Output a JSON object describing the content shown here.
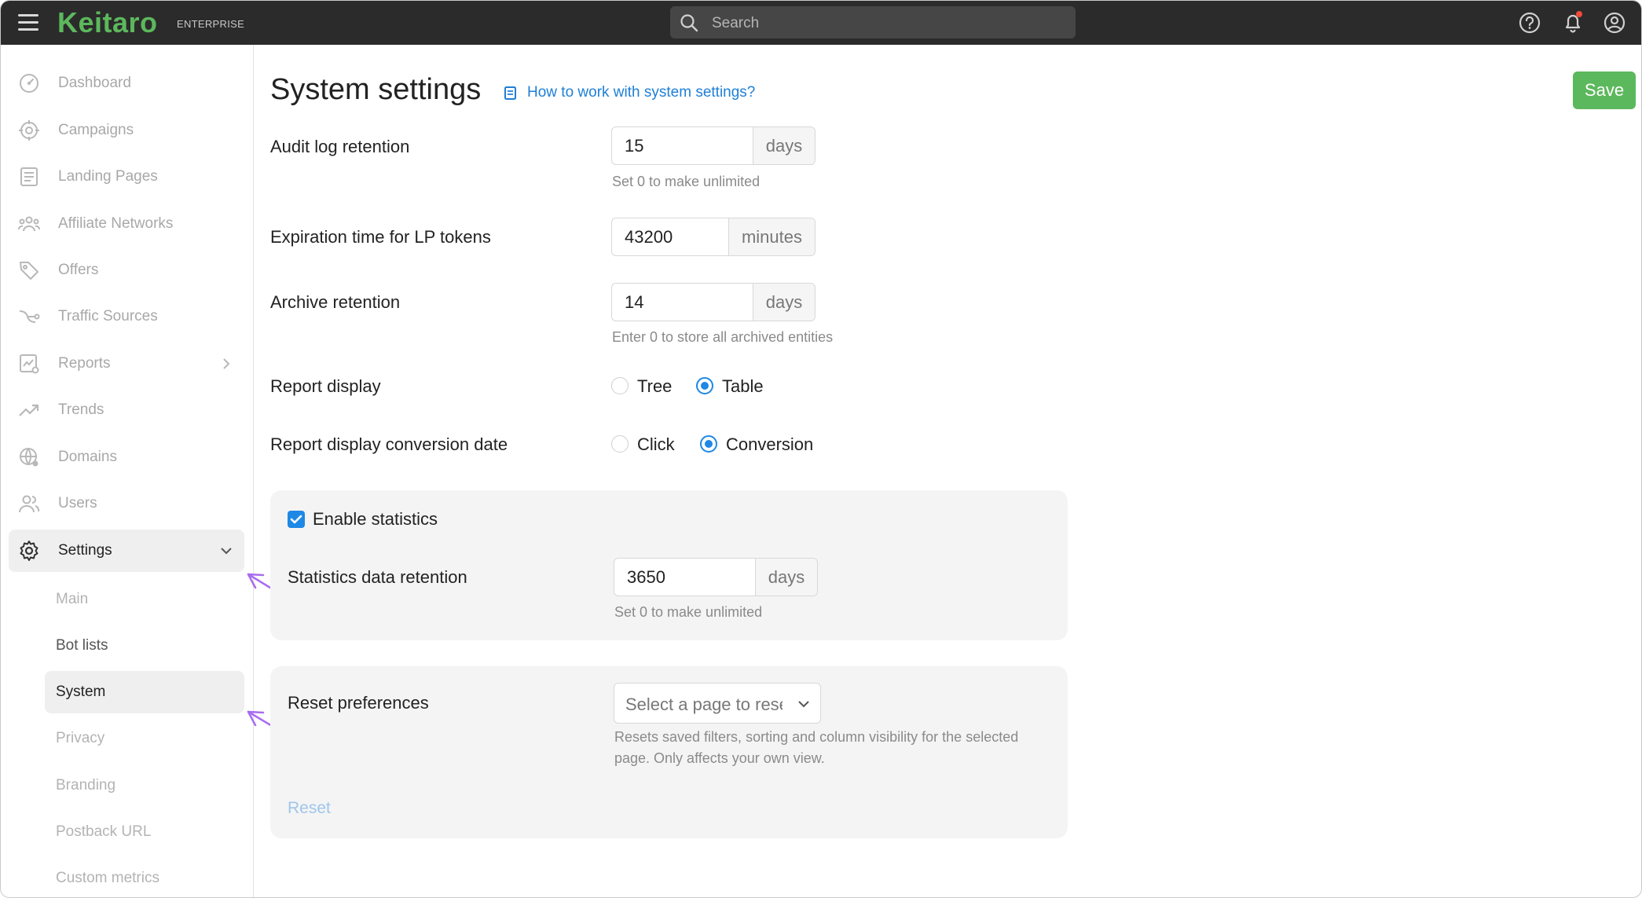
{
  "topbar": {
    "logo": "Keitaro",
    "logo_sub": "ENTERPRISE",
    "search_placeholder": "Search"
  },
  "sidebar": {
    "items": [
      {
        "label": "Dashboard",
        "icon": "dashboard-icon"
      },
      {
        "label": "Campaigns",
        "icon": "target-icon"
      },
      {
        "label": "Landing Pages",
        "icon": "page-icon"
      },
      {
        "label": "Affiliate Networks",
        "icon": "people-network-icon"
      },
      {
        "label": "Offers",
        "icon": "tag-icon"
      },
      {
        "label": "Traffic Sources",
        "icon": "traffic-icon"
      },
      {
        "label": "Reports",
        "icon": "report-chart-icon"
      },
      {
        "label": "Trends",
        "icon": "trend-icon"
      },
      {
        "label": "Domains",
        "icon": "globe-icon"
      },
      {
        "label": "Users",
        "icon": "users-icon"
      },
      {
        "label": "Settings",
        "icon": "gear-icon"
      }
    ],
    "settings_sub": [
      {
        "label": "Main"
      },
      {
        "label": "Bot lists"
      },
      {
        "label": "System"
      },
      {
        "label": "Privacy"
      },
      {
        "label": "Branding"
      },
      {
        "label": "Postback URL"
      },
      {
        "label": "Custom metrics"
      }
    ]
  },
  "main": {
    "title": "System settings",
    "help_link": "How to work with system settings?",
    "save_label": "Save",
    "audit": {
      "label": "Audit log retention",
      "value": "15",
      "unit": "days",
      "hint": "Set 0 to make unlimited"
    },
    "lp_tokens": {
      "label": "Expiration time for LP tokens",
      "value": "43200",
      "unit": "minutes"
    },
    "archive": {
      "label": "Archive retention",
      "value": "14",
      "unit": "days",
      "hint": "Enter 0 to store all archived entities"
    },
    "report_display": {
      "label": "Report display",
      "options": [
        "Tree",
        "Table"
      ],
      "selected": "Table"
    },
    "report_conv_date": {
      "label": "Report display conversion date",
      "options": [
        "Click",
        "Conversion"
      ],
      "selected": "Conversion"
    },
    "stats": {
      "checkbox_label": "Enable statistics",
      "checked": true,
      "retention_label": "Statistics data retention",
      "value": "3650",
      "unit": "days",
      "hint": "Set 0 to make unlimited"
    },
    "reset": {
      "label": "Reset preferences",
      "select_placeholder": "Select a page to reset",
      "hint_line1": "Resets saved filters, sorting and column visibility for the selected",
      "hint_line2": "page. Only affects your own view.",
      "button": "Reset"
    }
  },
  "colors": {
    "accent_green": "#5cb85c",
    "link_blue": "#1e7fd6",
    "radio_blue": "#1e88e5",
    "arrow_purple": "#a86cf0"
  }
}
